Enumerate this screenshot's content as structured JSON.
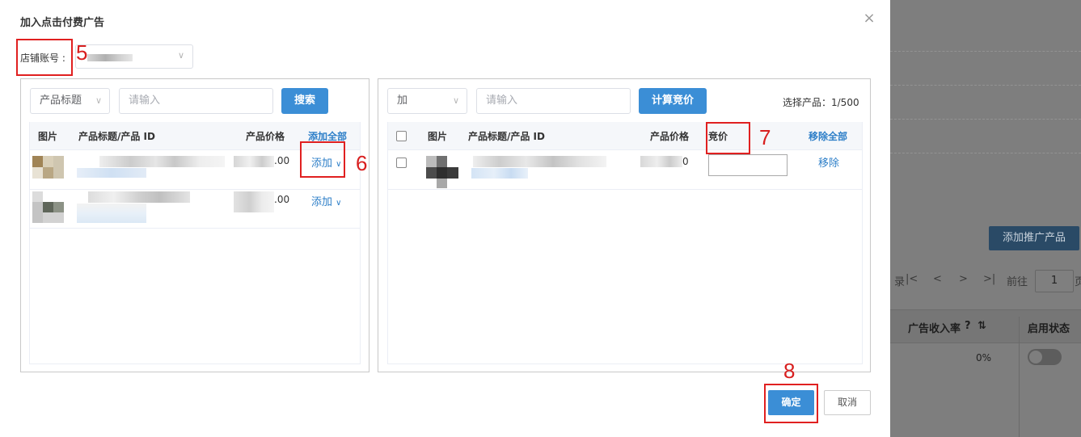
{
  "dialog": {
    "title": "加入点击付费广告",
    "close_icon": "×",
    "shop_label": "店铺账号 :",
    "confirm_label": "确定",
    "cancel_label": "取消"
  },
  "annotations": {
    "n5": "5",
    "n6": "6",
    "n7": "7",
    "n8": "8"
  },
  "left_panel": {
    "filter_select": "产品标题",
    "search_placeholder": "请输入",
    "search_button": "搜索",
    "columns": {
      "image": "图片",
      "title": "产品标题/产品 ID",
      "price": "产品价格",
      "add_all": "添加全部"
    },
    "rows": [
      {
        "price_suffix": ".00",
        "action": "添加"
      },
      {
        "price_suffix": ".00",
        "action": "添加"
      }
    ]
  },
  "right_panel": {
    "op_select": "加",
    "input_placeholder": "请输入",
    "calc_button": "计算竞价",
    "selected_count": "选择产品：1/500",
    "columns": {
      "image": "图片",
      "title": "产品标题/产品 ID",
      "price": "产品价格",
      "bid": "竞价",
      "remove_all": "移除全部"
    },
    "rows": [
      {
        "price_suffix": "0",
        "action": "移除"
      }
    ]
  },
  "background": {
    "add_promo_button": "添加推广产品",
    "goto_label": "前往",
    "goto_value": "1",
    "page_suffix": "页",
    "col_ad_revenue": "广告收入率",
    "col_enable": "启用状态",
    "pct_value": "0%"
  },
  "colors": {
    "accent": "#3b8ed6",
    "annotation": "#e02020",
    "link": "#2e7fc8"
  }
}
